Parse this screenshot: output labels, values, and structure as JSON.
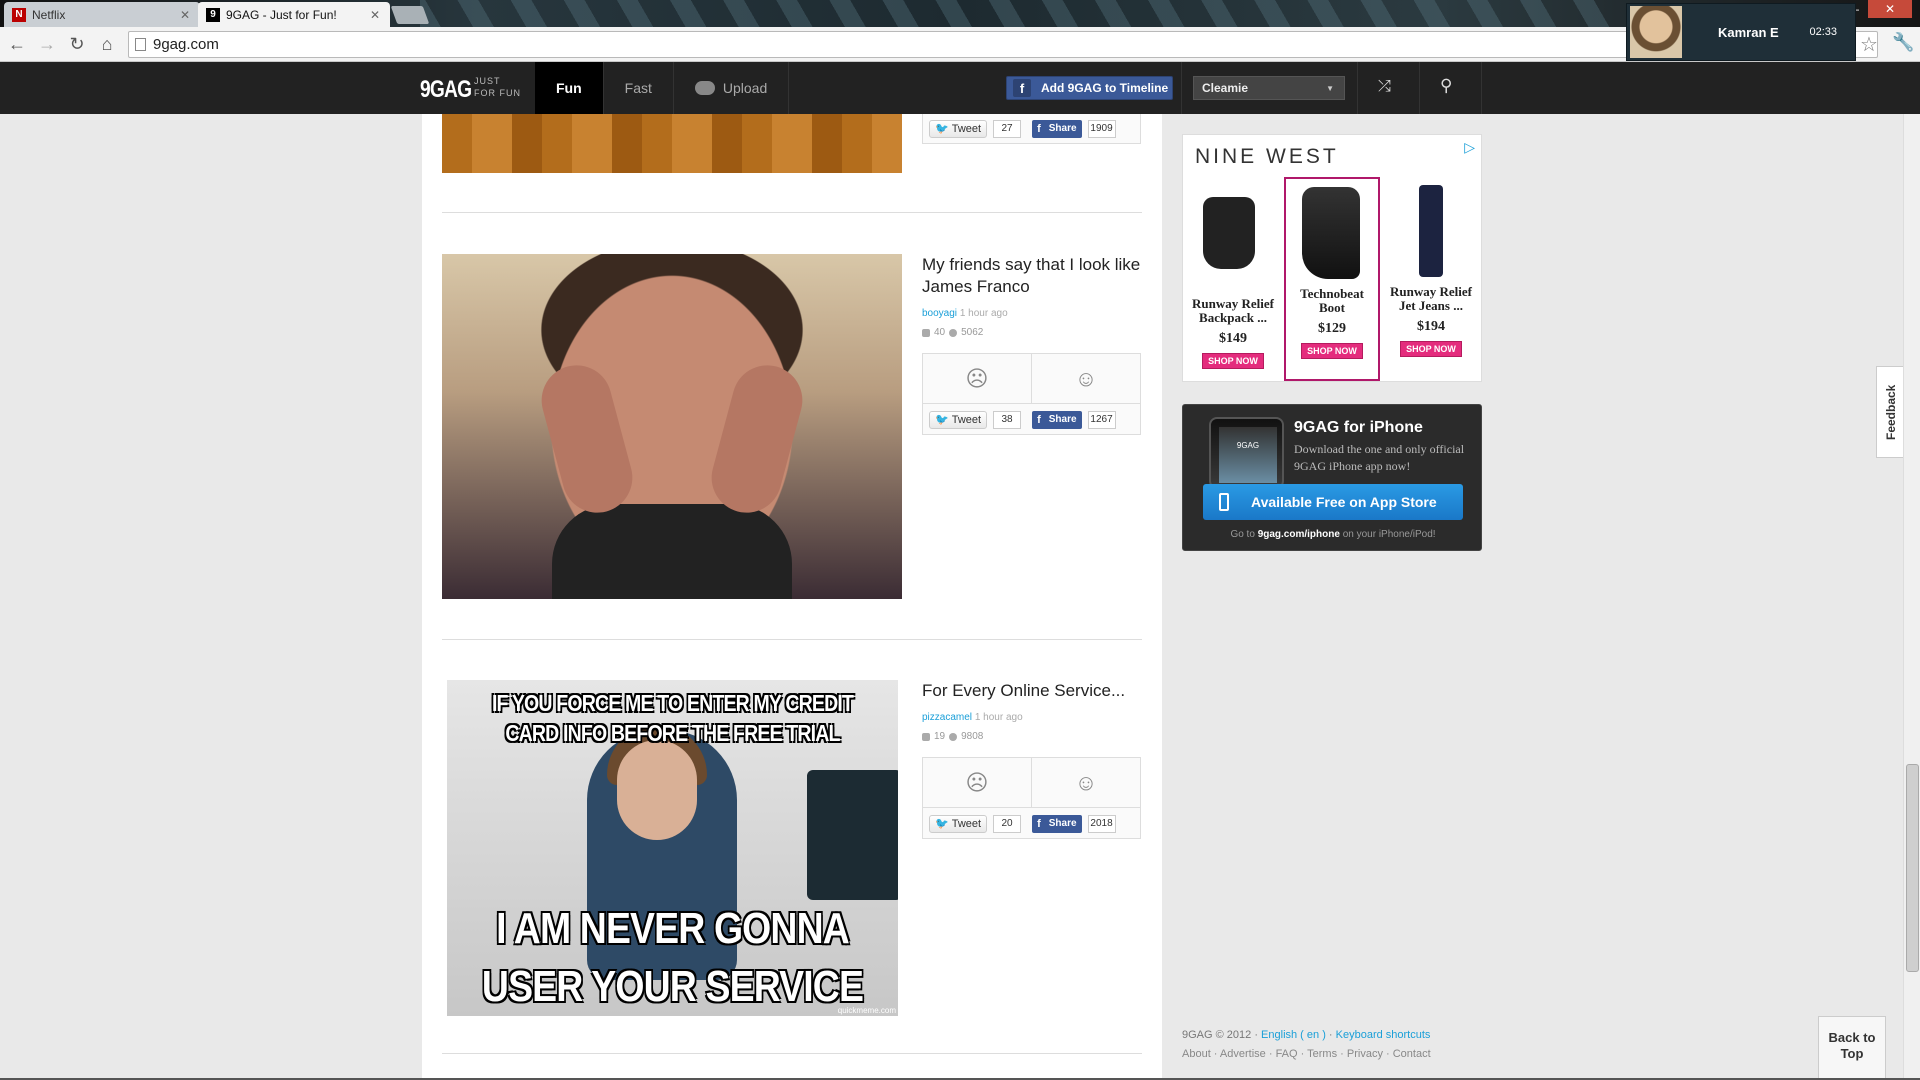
{
  "browser": {
    "tabs": [
      {
        "label": "Netflix",
        "favicon": "N"
      },
      {
        "label": "9GAG - Just for Fun!",
        "favicon": "9"
      }
    ],
    "url": "9gag.com",
    "user": {
      "name": "Kamran E",
      "time": "02:33"
    }
  },
  "header": {
    "logo": "9GAG",
    "logo_sub_1": "JUST",
    "logo_sub_2": "FOR FUN",
    "nav": [
      "Fun",
      "Fast",
      "Upload"
    ],
    "fb_timeline": "Add 9GAG to Timeline",
    "account_select": "Cleamie"
  },
  "posts": [
    {
      "tweet": "Tweet",
      "tweet_count": "27",
      "share": "Share",
      "share_count": "1909"
    },
    {
      "title": "My friends say that I look like James Franco",
      "author": "booyagi",
      "time": "1 hour ago",
      "comments": "40",
      "views": "5062",
      "tweet": "Tweet",
      "tweet_count": "38",
      "share": "Share",
      "share_count": "1267"
    },
    {
      "title": "For Every Online Service...",
      "author": "pizzacamel",
      "time": "1 hour ago",
      "comments": "19",
      "views": "9808",
      "meme_top": "IF YOU FORCE ME TO ENTER MY CREDIT CARD INFO BEFORE THE FREE TRIAL",
      "meme_bottom": "I AM NEVER GONNA USER YOUR SERVICE",
      "meme_watermark": "quickmeme.com",
      "tweet": "Tweet",
      "tweet_count": "20",
      "share": "Share",
      "share_count": "2018"
    }
  ],
  "ad": {
    "brand": "NINE WEST",
    "items": [
      {
        "name": "Runway Relief Backpack ...",
        "price": "$149",
        "cta": "SHOP NOW"
      },
      {
        "name": "Technobeat Boot",
        "price": "$129",
        "cta": "SHOP NOW"
      },
      {
        "name": "Runway Relief Jet Jeans ...",
        "price": "$194",
        "cta": "SHOP NOW"
      }
    ]
  },
  "iphone": {
    "title": "9GAG for iPhone",
    "desc": "Download the one and only official 9GAG iPhone app now!",
    "button": "Available Free on App Store",
    "foot_pre": "Go to",
    "foot_link": "9gag.com/iphone",
    "foot_post": "on your iPhone/iPod!",
    "screen_text": "9GAG"
  },
  "footer": {
    "copyright": "9GAG © 2012",
    "language": "English ( en )",
    "shortcuts": "Keyboard shortcuts",
    "links": [
      "About",
      "Advertise",
      "FAQ",
      "Terms",
      "Privacy",
      "Contact"
    ]
  },
  "feedback": "Feedback",
  "back_to_top_1": "Back to",
  "back_to_top_2": "Top",
  "colors": {
    "accent": "#1a9fd8",
    "facebook": "#3b5998",
    "header": "#222222",
    "shop": "#e42c7d"
  }
}
